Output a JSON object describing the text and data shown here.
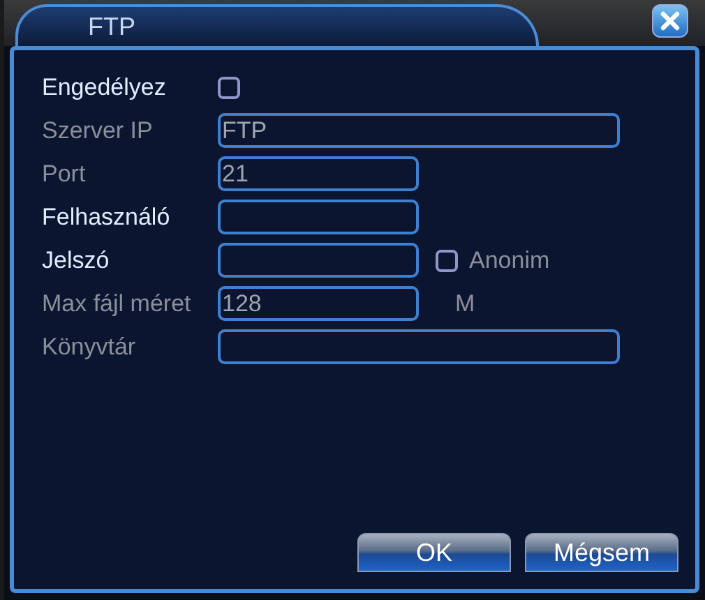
{
  "window": {
    "title": "FTP"
  },
  "rows": [
    {
      "kind": "checkbox",
      "label": "Engedélyez",
      "disabled": false,
      "checked": false
    },
    {
      "kind": "field-wide",
      "label": "Szerver IP",
      "disabled": true,
      "value": "FTP"
    },
    {
      "kind": "field",
      "label": "Port",
      "disabled": true,
      "value": "21"
    },
    {
      "kind": "field",
      "label": "Felhasználó",
      "disabled": false
    },
    {
      "kind": "field",
      "label": "Jelszó",
      "disabled": false,
      "option": {
        "label": "Anonim",
        "checked": false,
        "disabled": true
      }
    },
    {
      "kind": "field",
      "label": "Max fájl méret",
      "disabled": true,
      "value": "128",
      "unit": "M"
    },
    {
      "kind": "field-wide",
      "label": "Könyvtár",
      "disabled": true
    }
  ],
  "buttons": [
    "OK",
    "Mégsem"
  ]
}
